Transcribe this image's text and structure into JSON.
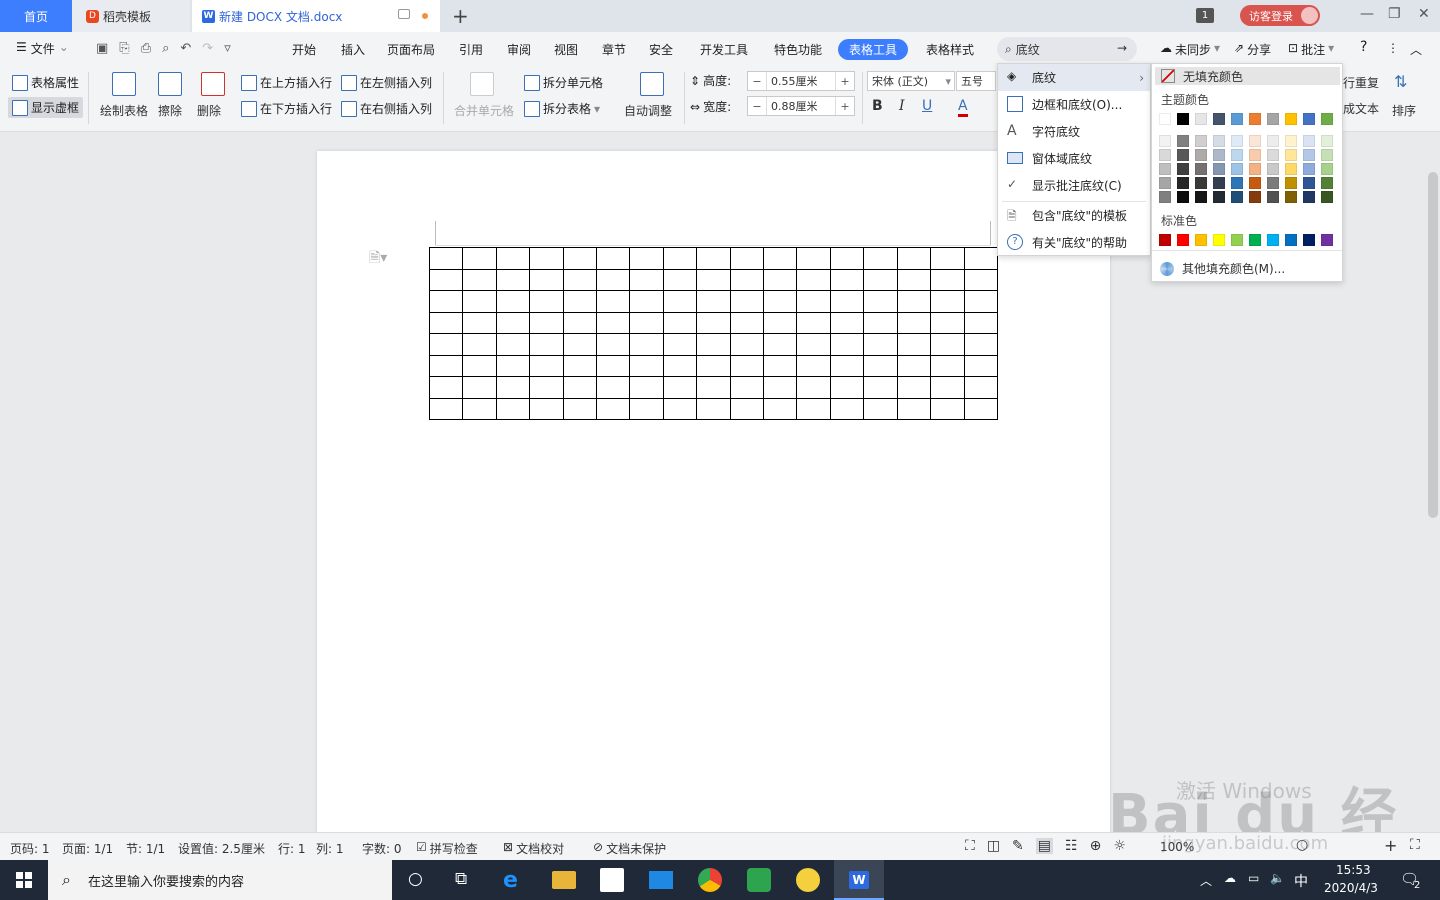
{
  "tabs": {
    "home": "首页",
    "template": "稻壳模板",
    "doc": "新建 DOCX 文档.docx"
  },
  "window": {
    "count": "1",
    "login": "访客登录"
  },
  "menu": {
    "file": "文件",
    "items": [
      "开始",
      "插入",
      "页面布局",
      "引用",
      "审阅",
      "视图",
      "章节",
      "安全",
      "开发工具",
      "特色功能"
    ],
    "table_tools": "表格工具",
    "table_style": "表格样式",
    "search_value": "底纹",
    "sync": "未同步",
    "share": "分享",
    "comment": "批注",
    "help": "?"
  },
  "ribbon": {
    "table_props": "表格属性",
    "show_grid": "显示虚框",
    "draw_table": "绘制表格",
    "eraser": "擦除",
    "delete": "删除",
    "insert_above": "在上方插入行",
    "insert_below": "在下方插入行",
    "insert_left": "在左侧插入列",
    "insert_right": "在右侧插入列",
    "merge": "合并单元格",
    "split_cell": "拆分单元格",
    "split_table": "拆分表格",
    "auto_fit": "自动调整",
    "height_label": "高度:",
    "height_value": "0.55厘米",
    "width_label": "宽度:",
    "width_value": "0.88厘米",
    "font": "宋体 (正文)",
    "size": "五号",
    "bold": "B",
    "italic": "I",
    "underline": "U",
    "font_color": "A",
    "repeat_header": "行重复",
    "to_text": "成文本",
    "sort": "排序"
  },
  "shade_menu": {
    "items": [
      "底纹",
      "边框和底纹(O)...",
      "字符底纹",
      "窗体域底纹",
      "显示批注底纹(C)",
      "包含\"底纹\"的模板",
      "有关\"底纹\"的帮助"
    ]
  },
  "submenu": {
    "no_fill": "无填充颜色",
    "theme_colors": "主题颜色",
    "standard_colors": "标准色",
    "more_colors": "其他填充颜色(M)...",
    "theme_top": [
      "#ffffff",
      "#000000",
      "#e7e6e6",
      "#44546a",
      "#5b9bd5",
      "#ed7d31",
      "#a5a5a5",
      "#ffc000",
      "#4472c4",
      "#70ad47"
    ],
    "theme_shades": [
      [
        "#f2f2f2",
        "#d9d9d9",
        "#bfbfbf",
        "#a6a6a6",
        "#808080"
      ],
      [
        "#808080",
        "#595959",
        "#404040",
        "#262626",
        "#0d0d0d"
      ],
      [
        "#d0cece",
        "#aeaaaa",
        "#757171",
        "#3b3838",
        "#161616"
      ],
      [
        "#d6dce5",
        "#adb9ca",
        "#8497b0",
        "#333f50",
        "#222a35"
      ],
      [
        "#deebf7",
        "#bdd7ee",
        "#9dc3e6",
        "#2e75b6",
        "#1f4e79"
      ],
      [
        "#fbe5d6",
        "#f8cbad",
        "#f4b183",
        "#c55a11",
        "#843c0c"
      ],
      [
        "#ededed",
        "#dbdbdb",
        "#c9c9c9",
        "#7b7b7b",
        "#525252"
      ],
      [
        "#fff2cc",
        "#ffe699",
        "#ffd966",
        "#bf9000",
        "#7f6000"
      ],
      [
        "#dae3f3",
        "#b4c7e7",
        "#8faadc",
        "#2f5597",
        "#203864"
      ],
      [
        "#e2f0d9",
        "#c5e0b4",
        "#a9d18e",
        "#548235",
        "#385723"
      ]
    ],
    "standard": [
      "#c00000",
      "#ff0000",
      "#ffc000",
      "#ffff00",
      "#92d050",
      "#00b050",
      "#00b0f0",
      "#0070c0",
      "#002060",
      "#7030a0"
    ]
  },
  "status": {
    "page_num": "页码: 1",
    "page": "页面: 1/1",
    "section": "节: 1/1",
    "setting": "设置值: 2.5厘米",
    "row": "行: 1",
    "col": "列: 1",
    "words": "字数: 0",
    "spell": "拼写检查",
    "proof": "文档校对",
    "protect": "文档未保护",
    "zoom": "100%"
  },
  "taskbar": {
    "search_placeholder": "在这里输入你要搜索的内容",
    "time": "15:53",
    "date": "2020/4/3",
    "ime": "中",
    "notif": "2"
  },
  "watermark": {
    "activate": "激活 Windows",
    "baidu": "Bai du 经验",
    "url": "jingyan.baidu.com"
  },
  "table": {
    "rows": 8,
    "cols": 17
  },
  "accent": "#3d7eff"
}
